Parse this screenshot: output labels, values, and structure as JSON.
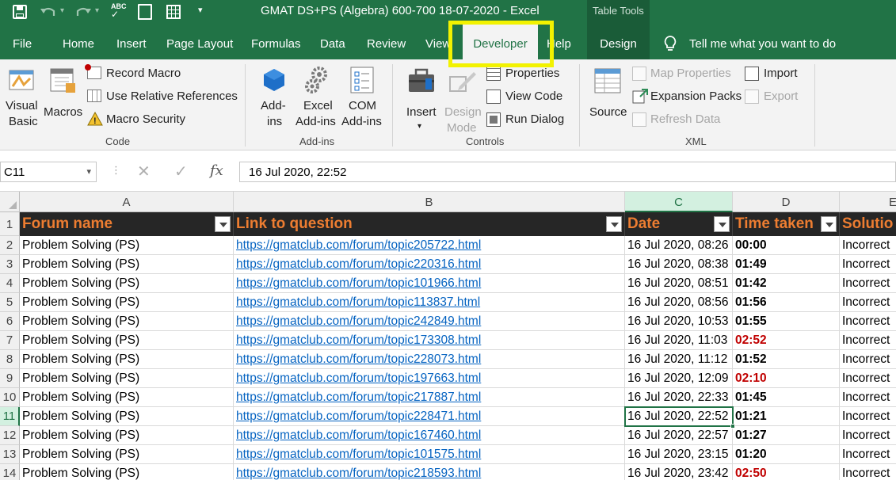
{
  "window": {
    "title": "GMAT DS+PS (Algebra) 600-700 18-07-2020  -  Excel",
    "context_tab": "Table Tools"
  },
  "tabs": [
    "File",
    "Home",
    "Insert",
    "Page Layout",
    "Formulas",
    "Data",
    "Review",
    "View",
    "Developer",
    "Help",
    "Design"
  ],
  "tell_me": "Tell me what you want to do",
  "ribbon": {
    "code": {
      "visual_basic": [
        "Visual",
        "Basic"
      ],
      "macros": "Macros",
      "record_macro": "Record Macro",
      "use_relative": "Use Relative References",
      "macro_security": "Macro Security",
      "label": "Code"
    },
    "addins": {
      "addins": [
        "Add-",
        "ins"
      ],
      "excel_addins": [
        "Excel",
        "Add-ins"
      ],
      "com_addins": [
        "COM",
        "Add-ins"
      ],
      "label": "Add-ins"
    },
    "controls": {
      "insert": "Insert",
      "design_mode": [
        "Design",
        "Mode"
      ],
      "properties": "Properties",
      "view_code": "View Code",
      "run_dialog": "Run Dialog",
      "label": "Controls"
    },
    "xml": {
      "source": "Source",
      "map_properties": "Map Properties",
      "expansion_packs": "Expansion Packs",
      "refresh_data": "Refresh Data",
      "import": "Import",
      "export": "Export",
      "label": "XML"
    }
  },
  "formula_bar": {
    "name_box": "C11",
    "value": "16 Jul 2020, 22:52",
    "fx": "fx"
  },
  "columns": [
    "A",
    "B",
    "C",
    "D",
    "E"
  ],
  "headers": [
    "Forum name",
    "Link to question",
    "Date",
    "Time taken",
    "Solutio"
  ],
  "rows": [
    {
      "n": "2",
      "forum": "Problem Solving (PS)",
      "link": "https://gmatclub.com/forum/topic205722.html",
      "date": "16 Jul 2020, 08:26",
      "time": "00:00",
      "red": false,
      "sol": "Incorrect"
    },
    {
      "n": "3",
      "forum": "Problem Solving (PS)",
      "link": "https://gmatclub.com/forum/topic220316.html",
      "date": "16 Jul 2020, 08:38",
      "time": "01:49",
      "red": false,
      "sol": "Incorrect"
    },
    {
      "n": "4",
      "forum": "Problem Solving (PS)",
      "link": "https://gmatclub.com/forum/topic101966.html",
      "date": "16 Jul 2020, 08:51",
      "time": "01:42",
      "red": false,
      "sol": "Incorrect"
    },
    {
      "n": "5",
      "forum": "Problem Solving (PS)",
      "link": "https://gmatclub.com/forum/topic113837.html",
      "date": "16 Jul 2020, 08:56",
      "time": "01:56",
      "red": false,
      "sol": "Incorrect"
    },
    {
      "n": "6",
      "forum": "Problem Solving (PS)",
      "link": "https://gmatclub.com/forum/topic242849.html",
      "date": "16 Jul 2020, 10:53",
      "time": "01:55",
      "red": false,
      "sol": "Incorrect"
    },
    {
      "n": "7",
      "forum": "Problem Solving (PS)",
      "link": "https://gmatclub.com/forum/topic173308.html",
      "date": "16 Jul 2020, 11:03",
      "time": "02:52",
      "red": true,
      "sol": "Incorrect"
    },
    {
      "n": "8",
      "forum": "Problem Solving (PS)",
      "link": "https://gmatclub.com/forum/topic228073.html",
      "date": "16 Jul 2020, 11:12",
      "time": "01:52",
      "red": false,
      "sol": "Incorrect"
    },
    {
      "n": "9",
      "forum": "Problem Solving (PS)",
      "link": "https://gmatclub.com/forum/topic197663.html",
      "date": "16 Jul 2020, 12:09",
      "time": "02:10",
      "red": true,
      "sol": "Incorrect"
    },
    {
      "n": "10",
      "forum": "Problem Solving (PS)",
      "link": "https://gmatclub.com/forum/topic217887.html",
      "date": "16 Jul 2020, 22:33",
      "time": "01:45",
      "red": false,
      "sol": "Incorrect"
    },
    {
      "n": "11",
      "forum": "Problem Solving (PS)",
      "link": "https://gmatclub.com/forum/topic228471.html",
      "date": "16 Jul 2020, 22:52",
      "time": "01:21",
      "red": false,
      "sol": "Incorrect"
    },
    {
      "n": "12",
      "forum": "Problem Solving (PS)",
      "link": "https://gmatclub.com/forum/topic167460.html",
      "date": "16 Jul 2020, 22:57",
      "time": "01:27",
      "red": false,
      "sol": "Incorrect"
    },
    {
      "n": "13",
      "forum": "Problem Solving (PS)",
      "link": "https://gmatclub.com/forum/topic101575.html",
      "date": "16 Jul 2020, 23:15",
      "time": "01:20",
      "red": false,
      "sol": "Incorrect"
    },
    {
      "n": "14",
      "forum": "Problem Solving (PS)",
      "link": "https://gmatclub.com/forum/topic218593.html",
      "date": "16 Jul 2020, 23:42",
      "time": "02:50",
      "red": true,
      "sol": "Incorrect"
    }
  ],
  "colors": {
    "excel_green": "#217346",
    "highlight": "#f2f200",
    "header_bg": "#262626",
    "header_text": "#ed7d31",
    "link": "#0563c1",
    "late": "#c00000"
  }
}
